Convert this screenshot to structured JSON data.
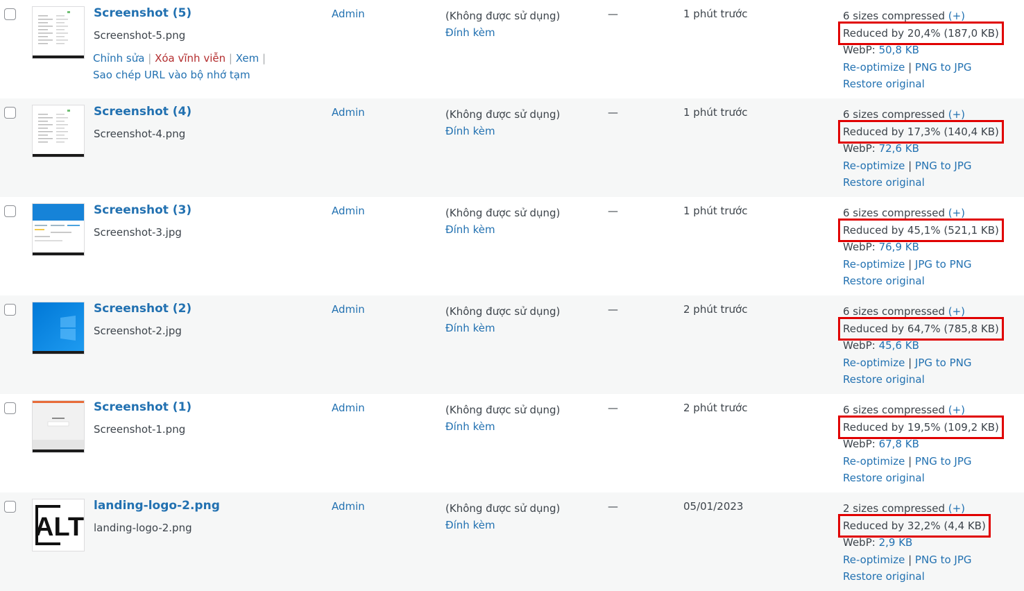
{
  "labels": {
    "edit": "Chỉnh sửa",
    "delete": "Xóa vĩnh viễn",
    "view": "Xem",
    "copy_url": "Sao chép URL vào bộ nhớ tạm",
    "unattached": "(Không được sử dụng)",
    "attach": "Đính kèm",
    "dash": "—",
    "reoptimize": "Re-optimize",
    "restore": "Restore original",
    "plus": "(+)",
    "webp_prefix": "WebP:",
    "separator": "|"
  },
  "colors": {
    "link": "#2271b1",
    "delete": "#b32d2e",
    "highlight": "#e00000",
    "alt_row": "#f6f7f7"
  },
  "rows": [
    {
      "thumb_icon": "screenshot-5-thumbnail",
      "title": "Screenshot (5)",
      "filename": "Screenshot-5.png",
      "author": "Admin",
      "date": "1 phút trước",
      "sizes": "6 sizes compressed",
      "reduced": "Reduced by 20,4% (187,0 KB)",
      "webp": "50,8 KB",
      "convert": "PNG to JPG"
    },
    {
      "thumb_icon": "screenshot-4-thumbnail",
      "title": "Screenshot (4)",
      "filename": "Screenshot-4.png",
      "author": "Admin",
      "date": "1 phút trước",
      "sizes": "6 sizes compressed",
      "reduced": "Reduced by 17,3% (140,4 KB)",
      "webp": "72,6 KB",
      "convert": "PNG to JPG"
    },
    {
      "thumb_icon": "screenshot-3-thumbnail",
      "title": "Screenshot (3)",
      "filename": "Screenshot-3.jpg",
      "author": "Admin",
      "date": "1 phút trước",
      "sizes": "6 sizes compressed",
      "reduced": "Reduced by 45,1% (521,1 KB)",
      "webp": "76,9 KB",
      "convert": "JPG to PNG"
    },
    {
      "thumb_icon": "screenshot-2-thumbnail",
      "title": "Screenshot (2)",
      "filename": "Screenshot-2.jpg",
      "author": "Admin",
      "date": "2 phút trước",
      "sizes": "6 sizes compressed",
      "reduced": "Reduced by 64,7% (785,8 KB)",
      "webp": "45,6 KB",
      "convert": "JPG to PNG"
    },
    {
      "thumb_icon": "screenshot-1-thumbnail",
      "title": "Screenshot (1)",
      "filename": "Screenshot-1.png",
      "author": "Admin",
      "date": "2 phút trước",
      "sizes": "6 sizes compressed",
      "reduced": "Reduced by 19,5% (109,2 KB)",
      "webp": "67,8 KB",
      "convert": "PNG to JPG"
    },
    {
      "thumb_icon": "landing-logo-thumbnail",
      "title": "landing-logo-2.png",
      "filename": "landing-logo-2.png",
      "author": "Admin",
      "date": "05/01/2023",
      "sizes": "2 sizes compressed",
      "reduced": "Reduced by 32,2% (4,4 KB)",
      "webp": "2,9 KB",
      "convert": "PNG to JPG",
      "thumb_text": "ALT"
    }
  ]
}
